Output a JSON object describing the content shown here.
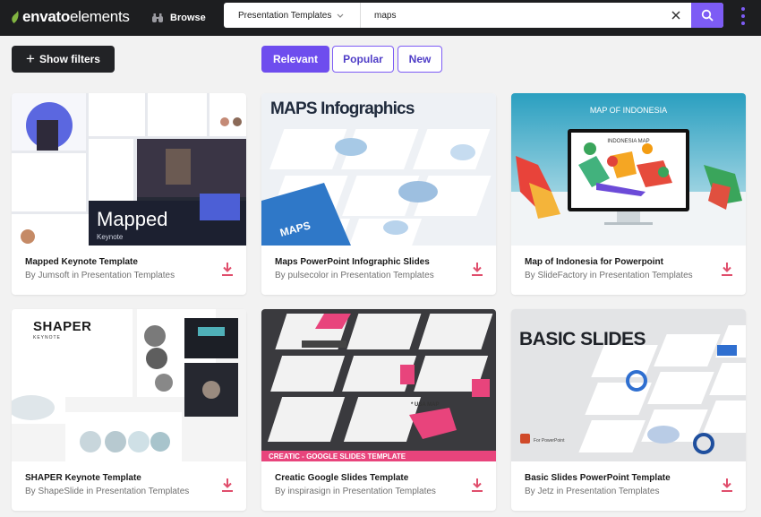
{
  "header": {
    "logo_envato": "envato",
    "logo_elements": "elements",
    "browse_label": "Browse",
    "category_select": "Presentation Templates",
    "search_value": "maps",
    "accent_color": "#7d5cf5",
    "brand_green": "#82b541"
  },
  "filters": {
    "show_filters_label": "Show filters",
    "sort": [
      {
        "label": "Relevant",
        "active": true
      },
      {
        "label": "Popular",
        "active": false
      },
      {
        "label": "New",
        "active": false
      }
    ]
  },
  "items": [
    {
      "title": "Mapped Keynote Template",
      "author": "By Jumsoft in Presentation Templates",
      "thumb_title": "Mapped",
      "thumb_subtitle": "Keynote"
    },
    {
      "title": "Maps PowerPoint Infographic Slides",
      "author": "By pulsecolor in Presentation Templates",
      "thumb_title": "MAPS Infographics",
      "thumb_subtitle": "MAPS"
    },
    {
      "title": "Map of Indonesia for Powerpoint",
      "author": "By SlideFactory in Presentation Templates",
      "thumb_title": "MAP OF INDONESIA",
      "thumb_subtitle": "INDONESIA MAP"
    },
    {
      "title": "SHAPER Keynote Template",
      "author": "By ShapeSlide in Presentation Templates",
      "thumb_title": "SHAPER",
      "thumb_subtitle": "KEYNOTE"
    },
    {
      "title": "Creatic Google Slides Template",
      "author": "By inspirasign in Presentation Templates",
      "thumb_title": "CREATIC - GOOGLE SLIDES TEMPLATE",
      "thumb_subtitle": "* USA MAP"
    },
    {
      "title": "Basic Slides PowerPoint Template",
      "author": "By Jetz in Presentation Templates",
      "thumb_title": "BASIC SLIDES",
      "thumb_subtitle": "For PowerPoint"
    }
  ]
}
